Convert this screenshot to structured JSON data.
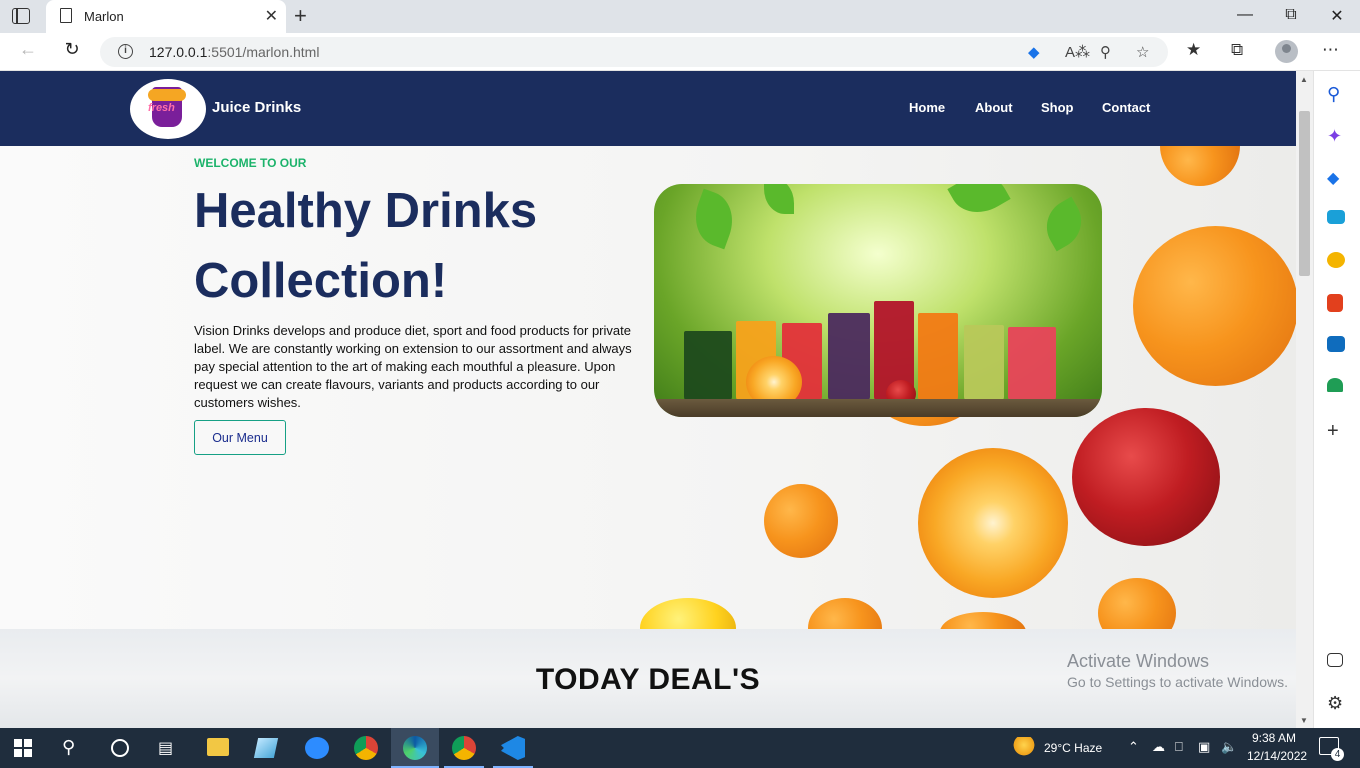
{
  "browser": {
    "tab_title": "Marlon",
    "url_host": "127.0.0.1",
    "url_rest": ":5501/marlon.html",
    "tab_close": "✕",
    "new_tab": "+"
  },
  "site": {
    "brand": "Juice Drinks",
    "logo_text": "fresh",
    "nav": [
      "Home",
      "About",
      "Shop",
      "Contact"
    ]
  },
  "hero": {
    "welcome": "WELCOME TO OUR",
    "title": "Healthy Drinks Collection!",
    "description": "Vision Drinks develops and produce diet, sport and food products for private label. We are constantly working on extension to our assortment and always pay special attention to the art of making each mouthful a pleasure. Upon request we can create flavours, variants and products according to our customers wishes.",
    "button": "Our Menu"
  },
  "deals": {
    "title": "TODAY DEAL'S"
  },
  "watermark": {
    "line1": "Activate Windows",
    "line2": "Go to Settings to activate Windows."
  },
  "taskbar": {
    "weather": "29°C  Haze",
    "time": "9:38 AM",
    "date": "12/14/2022",
    "notifications": "4"
  },
  "colors": {
    "header_bg": "#1b2d5e",
    "accent_green": "#1cb36b",
    "title_navy": "#1b2d5e"
  }
}
